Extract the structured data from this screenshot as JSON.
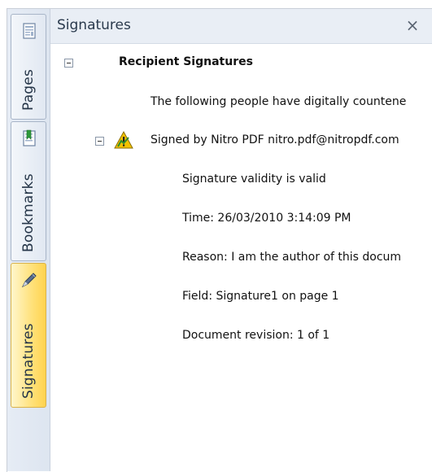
{
  "tabs": [
    {
      "label": "Pages",
      "icon": "page-icon"
    },
    {
      "label": "Bookmarks",
      "icon": "bookmark-icon"
    },
    {
      "label": "Signatures",
      "icon": "pen-icon",
      "active": true
    }
  ],
  "panel": {
    "title": "Signatures",
    "close_label": "×"
  },
  "tree": {
    "group_label": "Recipient Signatures",
    "description": "The following people have digitally countene",
    "signer": {
      "label": "Signed by Nitro PDF nitro.pdf@nitropdf.com",
      "status_icon": "warning-icon",
      "details": [
        "Signature validity is valid",
        "Time: 26/03/2010 3:14:09 PM",
        "Reason: I am the author of this docum",
        "Field: Signature1 on page 1",
        "Document revision: 1 of 1"
      ]
    }
  },
  "colors": {
    "active_tab": "#ffd34e",
    "warning": "#f2c200"
  }
}
